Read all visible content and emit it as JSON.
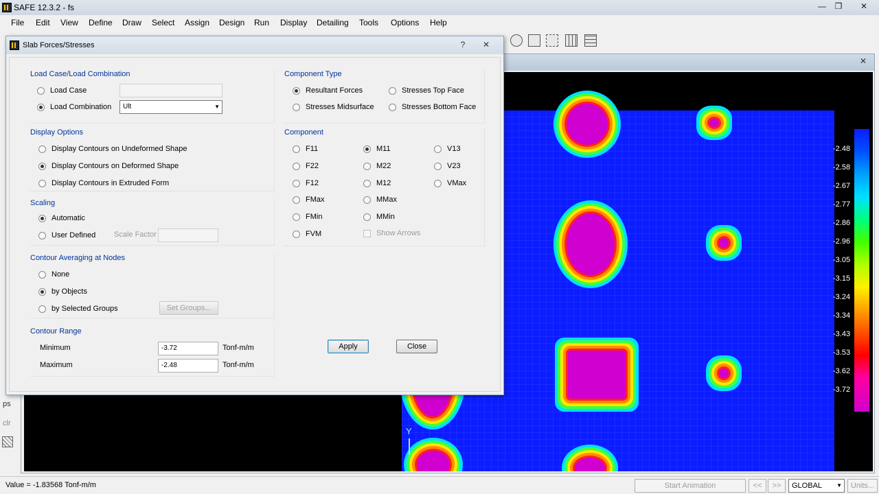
{
  "app": {
    "title": "SAFE 12.3.2 - fs",
    "minimize": "—",
    "restore": "❐",
    "close": "✕"
  },
  "menu": [
    "File",
    "Edit",
    "View",
    "Define",
    "Draw",
    "Select",
    "Assign",
    "Design",
    "Run",
    "Display",
    "Detailing",
    "Tools",
    "Options",
    "Help"
  ],
  "plot": {
    "close": "✕",
    "legend": [
      "-2.48",
      "-2.58",
      "-2.67",
      "-2.77",
      "-2.86",
      "-2.96",
      "-3.05",
      "-3.15",
      "-3.24",
      "-3.34",
      "-3.43",
      "-3.53",
      "-3.62",
      "-3.72"
    ],
    "axis_label": "Y",
    "left_labels": [
      "ps",
      "clr"
    ]
  },
  "status": {
    "value": "Value = -1.83568 Tonf-m/m",
    "start_animation": "Start Animation",
    "prev": "<<",
    "next": ">>",
    "coord_system": "GLOBAL",
    "units": "Units..."
  },
  "dialog": {
    "title": "Slab Forces/Stresses",
    "help": "?",
    "close": "✕",
    "load": {
      "title": "Load Case/Load Combination",
      "load_case": "Load Case",
      "load_combination": "Load Combination",
      "load_case_value": "",
      "combination_value": "Ult"
    },
    "display_options": {
      "title": "Display Options",
      "undeformed": "Display Contours on Undeformed Shape",
      "deformed": "Display Contours on Deformed Shape",
      "extruded": "Display Contours in Extruded Form"
    },
    "scaling": {
      "title": "Scaling",
      "automatic": "Automatic",
      "user_defined": "User Defined",
      "scale_factor": "Scale Factor",
      "scale_value": ""
    },
    "averaging": {
      "title": "Contour Averaging at Nodes",
      "none": "None",
      "by_objects": "by Objects",
      "by_groups": "by Selected Groups",
      "set_groups": "Set Groups..."
    },
    "range": {
      "title": "Contour Range",
      "min_label": "Minimum",
      "max_label": "Maximum",
      "min_value": "-3.72",
      "max_value": "-2.48",
      "unit": "Tonf-m/m"
    },
    "component_type": {
      "title": "Component Type",
      "resultant": "Resultant Forces",
      "top": "Stresses Top Face",
      "mid": "Stresses Midsurface",
      "bottom": "Stresses Bottom Face"
    },
    "component": {
      "title": "Component",
      "f11": "F11",
      "f22": "F22",
      "f12": "F12",
      "fmax": "FMax",
      "fmin": "FMin",
      "fvm": "FVM",
      "m11": "M11",
      "m22": "M22",
      "m12": "M12",
      "mmax": "MMax",
      "mmin": "MMin",
      "v13": "V13",
      "v23": "V23",
      "vmax": "VMax",
      "show_arrows": "Show Arrows"
    },
    "apply": "Apply",
    "close_btn": "Close"
  }
}
